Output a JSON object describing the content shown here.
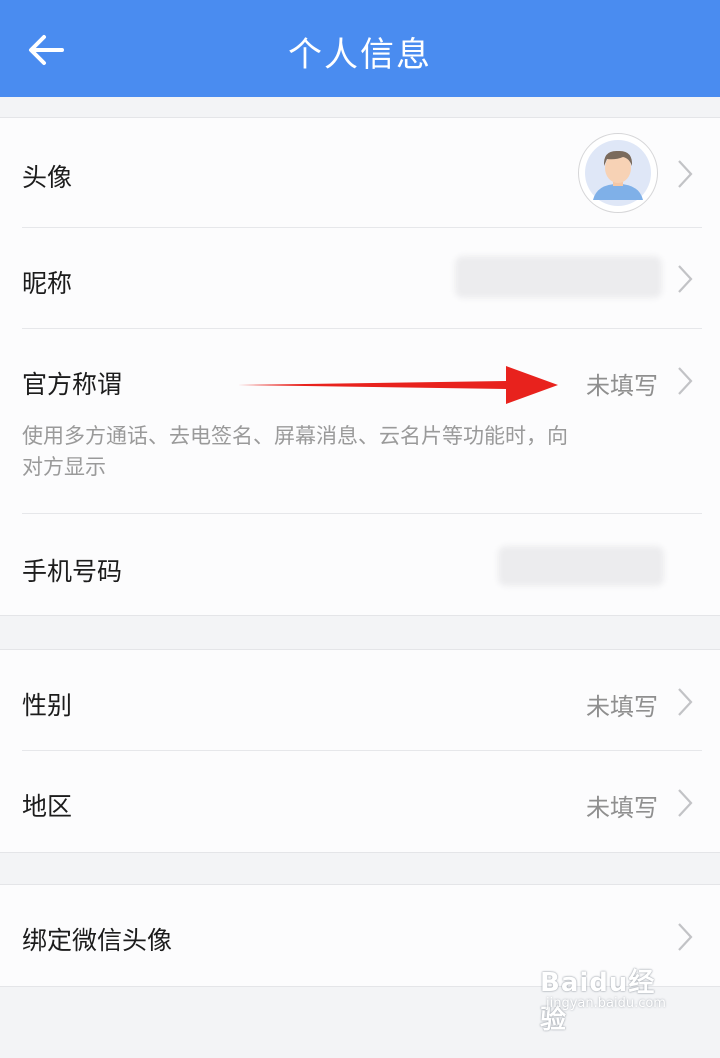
{
  "header": {
    "title": "个人信息",
    "bg_color": "#4a8cf0",
    "back_icon": "arrow-left-icon"
  },
  "profile": {
    "avatar_label": "头像",
    "nickname_label": "昵称",
    "official_title_label": "官方称谓",
    "official_title_value": "未填写",
    "official_title_hint": "使用多方通话、去电签名、屏幕消息、云名片等功能时，向对方显示",
    "phone_label": "手机号码"
  },
  "details": {
    "gender_label": "性别",
    "gender_value": "未填写",
    "region_label": "地区",
    "region_value": "未填写"
  },
  "wechat": {
    "bind_label": "绑定微信头像"
  },
  "annotation": {
    "arrow_color": "#e8221d"
  },
  "watermark": {
    "brand": "Baidu经验",
    "url": "jingyan.baidu.com"
  }
}
